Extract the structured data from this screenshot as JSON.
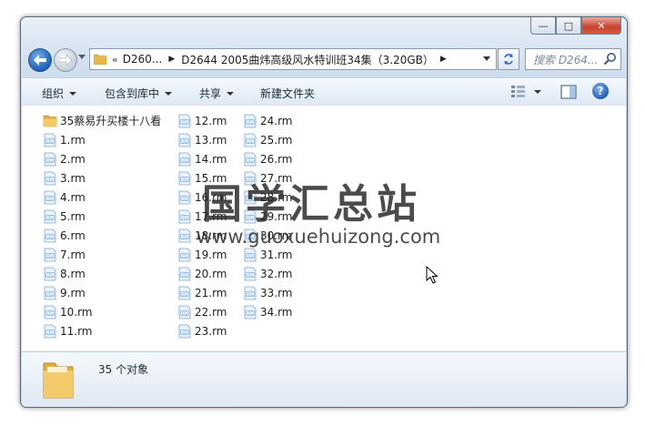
{
  "window": {
    "caption_buttons": {
      "minimize": "—",
      "maximize": "□",
      "close": "✕"
    }
  },
  "navigation": {
    "address_chevron": "«",
    "breadcrumb": [
      {
        "label": "D260..."
      },
      {
        "label": "D2644 2005曲炜高级风水特训班34集（3.20GB）"
      }
    ],
    "search_placeholder": "搜索 D264..."
  },
  "toolbar": {
    "organize": "组织",
    "include_in_library": "包含到库中",
    "share": "共享",
    "new_folder": "新建文件夹"
  },
  "files": {
    "column1": [
      {
        "name": "35蔡易升买楼十八看",
        "type": "folder"
      },
      {
        "name": "1.rm",
        "type": "rm"
      },
      {
        "name": "2.rm",
        "type": "rm"
      },
      {
        "name": "3.rm",
        "type": "rm"
      },
      {
        "name": "4.rm",
        "type": "rm"
      },
      {
        "name": "5.rm",
        "type": "rm"
      },
      {
        "name": "6.rm",
        "type": "rm"
      },
      {
        "name": "7.rm",
        "type": "rm"
      },
      {
        "name": "8.rm",
        "type": "rm"
      },
      {
        "name": "9.rm",
        "type": "rm"
      },
      {
        "name": "10.rm",
        "type": "rm"
      },
      {
        "name": "11.rm",
        "type": "rm"
      }
    ],
    "column2": [
      {
        "name": "12.rm",
        "type": "rm"
      },
      {
        "name": "13.rm",
        "type": "rm"
      },
      {
        "name": "14.rm",
        "type": "rm"
      },
      {
        "name": "15.rm",
        "type": "rm"
      },
      {
        "name": "16.rm",
        "type": "rm"
      },
      {
        "name": "17.rm",
        "type": "rm"
      },
      {
        "name": "18.rm",
        "type": "rm"
      },
      {
        "name": "19.rm",
        "type": "rm"
      },
      {
        "name": "20.rm",
        "type": "rm"
      },
      {
        "name": "21.rm",
        "type": "rm"
      },
      {
        "name": "22.rm",
        "type": "rm"
      },
      {
        "name": "23.rm",
        "type": "rm"
      }
    ],
    "column3": [
      {
        "name": "24.rm",
        "type": "rm"
      },
      {
        "name": "25.rm",
        "type": "rm"
      },
      {
        "name": "26.rm",
        "type": "rm"
      },
      {
        "name": "27.rm",
        "type": "rm"
      },
      {
        "name": "28.rm",
        "type": "rm"
      },
      {
        "name": "29.rm",
        "type": "rm"
      },
      {
        "name": "30.rm",
        "type": "rm"
      },
      {
        "name": "31.rm",
        "type": "rm"
      },
      {
        "name": "32.rm",
        "type": "rm"
      },
      {
        "name": "33.rm",
        "type": "rm"
      },
      {
        "name": "34.rm",
        "type": "rm"
      }
    ]
  },
  "details": {
    "item_count": "35 个对象"
  },
  "watermark": {
    "title": "国学汇总站",
    "url": "www.guoxuehuizong.com"
  },
  "colors": {
    "accent": "#1f5fb8",
    "frame": "#c9d8ea",
    "folder": "#e8b84a"
  }
}
